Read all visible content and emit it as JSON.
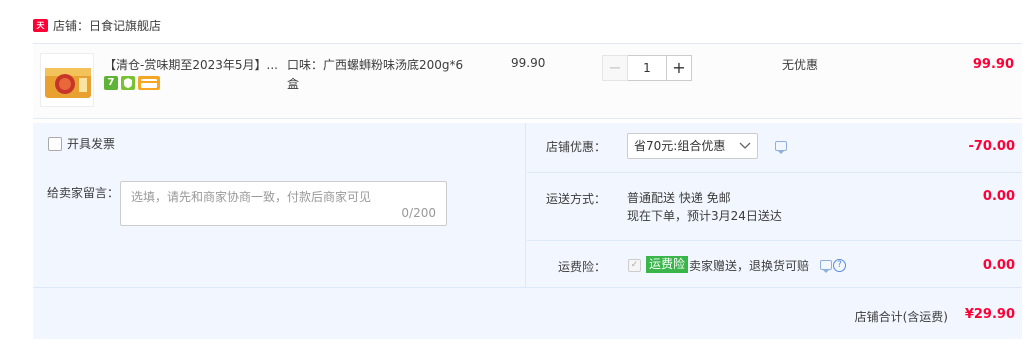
{
  "shop": {
    "badge": "天猫",
    "name": "店铺：日食记旗舰店"
  },
  "item": {
    "title": "【清仓-赏味期至2023年5月】...",
    "icons": [
      "seven-day-return-icon",
      "guarantee-shield-icon",
      "card-payment-icon"
    ],
    "icon_glyphs": {
      "seven": "7"
    },
    "spec": "口味：广西螺蛳粉味汤底200g*6盒",
    "unit_price": "99.90",
    "quantity": "1",
    "minus_label": "−",
    "plus_label": "+",
    "discount": "无优惠",
    "subtotal": "99.90"
  },
  "order_options": {
    "invoice_label": "开具发票",
    "memo_label": "给卖家留言：",
    "memo_placeholder": "选填，请先和商家协商一致，付款后商家可见",
    "memo_count": "0/200"
  },
  "shop_discount": {
    "label": "店铺优惠：",
    "selected": "省70元:组合优惠",
    "amount": "-70.00"
  },
  "shipping": {
    "label": "运送方式：",
    "line1": "普通配送 快递 免邮",
    "line2": "现在下单，预计3月24日送达",
    "amount": "0.00"
  },
  "insurance": {
    "label": "运费险：",
    "badge": "运费险",
    "text": "卖家赠送，退换货可赔",
    "help": "?",
    "amount": "0.00"
  },
  "total": {
    "label": "店铺合计(含运费)",
    "value": "¥29.90"
  },
  "colors": {
    "accent_price": "#ff0036",
    "panel_bg": "#f2f7ff",
    "tmall_red": "#ff0036",
    "insurance_green": "#39b54a"
  }
}
